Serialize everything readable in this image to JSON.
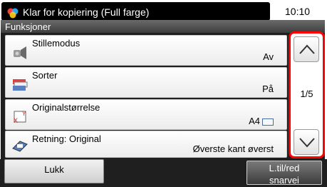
{
  "status": {
    "title": "Klar for kopiering (Full farge)",
    "time": "10:10",
    "icon": "color-copy-icon"
  },
  "panel": {
    "title": "Funksjoner"
  },
  "rows": [
    {
      "label": "Stillemodus",
      "value": "Av",
      "icon": "quiet-mode-icon"
    },
    {
      "label": "Sorter",
      "value": "På",
      "icon": "collate-icon"
    },
    {
      "label": "Originalstørrelse",
      "value": "A4",
      "icon": "original-size-icon"
    },
    {
      "label": "Retning: Original",
      "value": "Øverste kant øverst",
      "icon": "orientation-icon"
    }
  ],
  "scroll": {
    "page": "1/5",
    "up_icon": "chevron-up-icon",
    "down_icon": "chevron-down-icon",
    "highlight_color": "#ff0000"
  },
  "buttons": {
    "close": "Lukk",
    "shortcut_line1": "L.til/red",
    "shortcut_line2": "snarvei"
  }
}
